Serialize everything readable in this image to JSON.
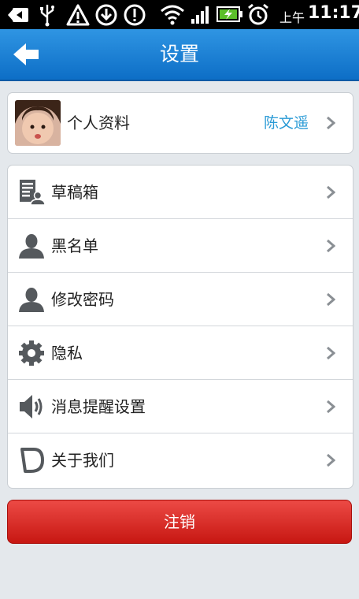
{
  "status_bar": {
    "ampm": "上午",
    "time": "11:17"
  },
  "title_bar": {
    "title": "设置"
  },
  "profile": {
    "label": "个人资料",
    "username": "陈文遥"
  },
  "menu": {
    "items": [
      {
        "label": "草稿箱",
        "icon": "draft-icon"
      },
      {
        "label": "黑名单",
        "icon": "user-block-icon"
      },
      {
        "label": "修改密码",
        "icon": "user-password-icon"
      },
      {
        "label": "隐私",
        "icon": "gear-icon"
      },
      {
        "label": "消息提醒设置",
        "icon": "speaker-icon"
      },
      {
        "label": "关于我们",
        "icon": "about-icon"
      }
    ]
  },
  "logout": {
    "label": "注销"
  },
  "colors": {
    "title_bar": "#1b82d6",
    "username": "#2b9bd6",
    "logout": "#d9302b"
  }
}
